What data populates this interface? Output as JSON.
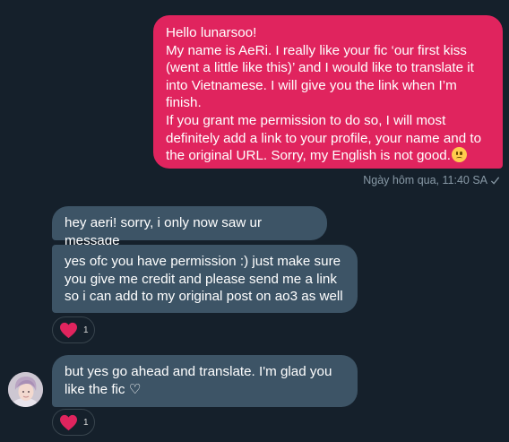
{
  "sent_message": {
    "lines": [
      "Hello lunarsoo!",
      "My name is AeRi. I really like your fic ‘our first kiss (went a little like this)’ and I would like to translate it into Vietnamese. I will give you the link when I’m finish.",
      "If you grant me permission to do so, I will most definitely add a link to your profile, your name and to the original URL. Sorry, my English is not good."
    ],
    "emoji": "worried-face-emoji",
    "timestamp": "Ngày hôm qua, 11:40 SA",
    "status_icon": "check-icon",
    "color": "#e0245e"
  },
  "received_messages": [
    {
      "text": "hey aeri! sorry, i only now saw ur message"
    },
    {
      "text": "yes ofc you have permission :) just make sure you give me credit and please send me a link so i can add to my original post on ao3 as well"
    },
    {
      "text": "but yes go ahead and translate. I'm glad you like the fic ♡"
    }
  ],
  "reactions": [
    {
      "icon": "heart-icon",
      "count": "1"
    },
    {
      "icon": "heart-icon",
      "count": "1"
    }
  ],
  "colors": {
    "background": "#15202b",
    "received_bubble": "#3d5466",
    "timestamp": "#8899a6",
    "heart": "#e0245e"
  }
}
